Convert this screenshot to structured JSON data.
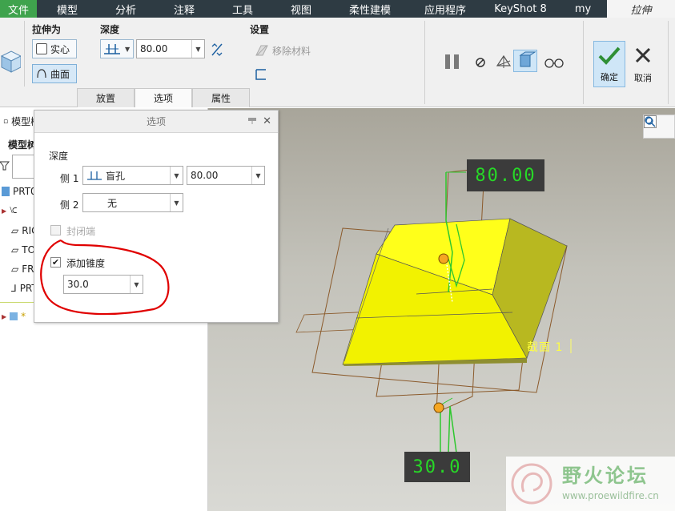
{
  "menubar": {
    "items": [
      "文件",
      "模型",
      "分析",
      "注释",
      "工具",
      "视图",
      "柔性建模",
      "应用程序",
      "KeyShot 8",
      "my",
      "拉伸"
    ]
  },
  "ribbon": {
    "extrude_as": {
      "label": "拉伸为",
      "solid": "实心",
      "surface": "曲面"
    },
    "depth": {
      "label": "深度",
      "value": "80.00"
    },
    "settings": {
      "label": "设置",
      "remove_material": "移除材料"
    },
    "tabs": [
      "放置",
      "选项",
      "属性"
    ],
    "confirm_label": "确定",
    "cancel_label": "取消"
  },
  "model_tree": {
    "header": "模型树",
    "subheader": "模型树",
    "items": [
      "PRT0001.PRT",
      "RIGHT",
      "TOP",
      "FRONT",
      "PRT_CSYS_DEF",
      "*"
    ]
  },
  "dialog": {
    "title": "选项",
    "depth_label": "深度",
    "side1_label": "侧 1",
    "side1_type": "盲孔",
    "side1_value": "80.00",
    "side2_label": "侧 2",
    "side2_type": "无",
    "capped_ends": "封闭端",
    "add_taper": "添加锥度",
    "taper_value": "30.0"
  },
  "viewport": {
    "dim_top": "80.00",
    "dim_bottom": "30.0",
    "section_label": "截面 1"
  },
  "watermark": {
    "brand": "野火论坛",
    "url": "www.proewildfire.cn"
  },
  "colors": {
    "menubar": "#2e3b43",
    "file_tab": "#3fa34d",
    "solid_yellow": "#ffff00",
    "dim_text": "#27d827",
    "annotation_red": "#e00000"
  }
}
